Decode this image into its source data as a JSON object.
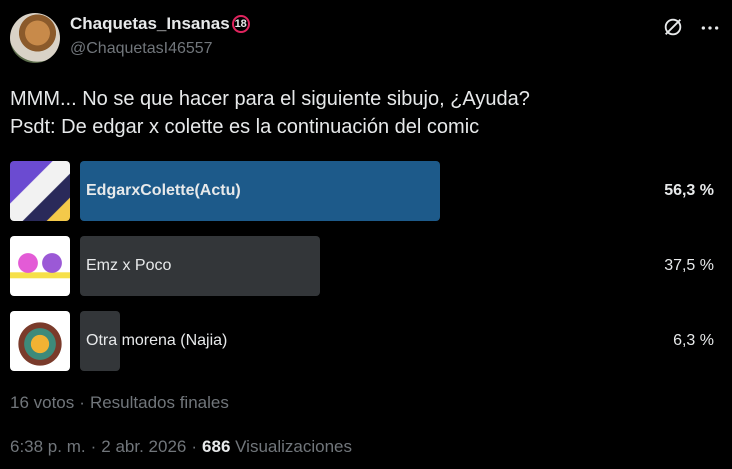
{
  "author": {
    "display_name": "Chaquetas_Insanas",
    "badge": "18",
    "handle": "@ChaquetasI46557"
  },
  "tweet": {
    "line1": "MMM... No se que hacer para el siguiente sibujo, ¿Ayuda?",
    "line2": "Psdt: De edgar x colette es la continuación del comic"
  },
  "poll": {
    "options": [
      {
        "label": "EdgarxColette(Actu)",
        "percent_label": "56,3 %",
        "percent": 56.3,
        "winner": true,
        "bar_color": "#1d5a8a"
      },
      {
        "label": "Emz x Poco",
        "percent_label": "37,5 %",
        "percent": 37.5,
        "winner": false,
        "bar_color": "#333639"
      },
      {
        "label": "Otra morena (Najia)",
        "percent_label": "6,3 %",
        "percent": 6.3,
        "winner": false,
        "bar_color": "#333639"
      }
    ],
    "meta": {
      "votes": "16 votos",
      "separator": "·",
      "status": "Resultados finales"
    }
  },
  "footer": {
    "time": "6:38 p. m.",
    "separator": "·",
    "date": "2 abr. 2026",
    "views_count": "686",
    "views_label": "Visualizaciones"
  },
  "icons": {
    "grok": "grok-icon",
    "more": "more-icon"
  },
  "colors": {
    "background": "#000000",
    "text": "#e7e9ea",
    "muted": "#71767b",
    "winner_bar": "#1d5a8a",
    "bar": "#333639",
    "badge_ring": "#e0245e"
  }
}
